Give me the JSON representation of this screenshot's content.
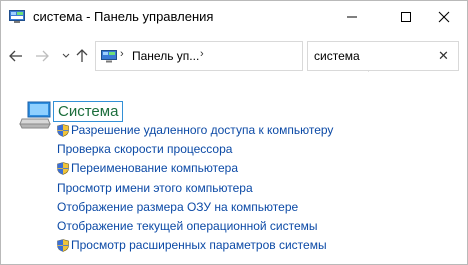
{
  "window": {
    "title": "система - Панель управления"
  },
  "address_bar": {
    "path_label": "Панель уп..."
  },
  "search": {
    "value": "система"
  },
  "section": {
    "title": "Система",
    "links": [
      {
        "label": "Разрешение удаленного доступа к компьютеру",
        "shield": true
      },
      {
        "label": "Проверка скорости процессора",
        "shield": false
      },
      {
        "label": "Переименование компьютера",
        "shield": true
      },
      {
        "label": "Просмотр имени этого компьютера",
        "shield": false
      },
      {
        "label": "Отображение размера ОЗУ на компьютере",
        "shield": false
      },
      {
        "label": "Отображение текущей операционной системы",
        "shield": false
      },
      {
        "label": "Просмотр расширенных параметров системы",
        "shield": true
      }
    ]
  },
  "colors": {
    "link": "#0c4aa6",
    "section_title": "#1c6e3c",
    "focus_border": "#3390d6"
  }
}
